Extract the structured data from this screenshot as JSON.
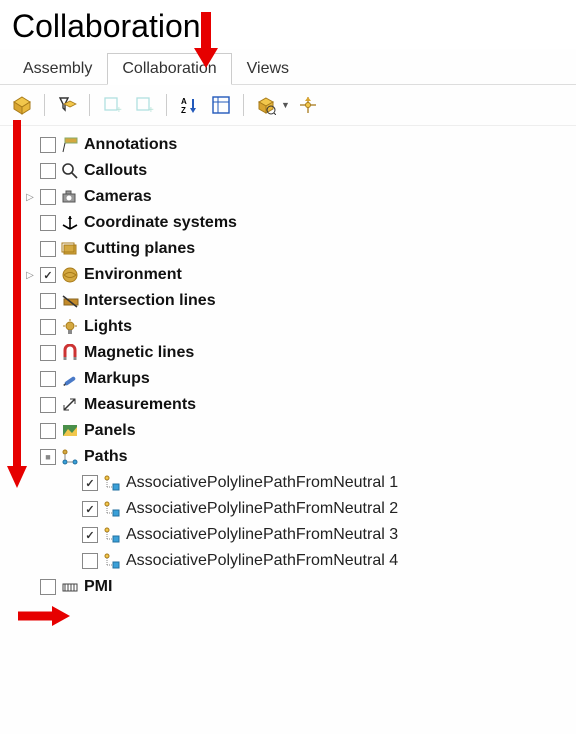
{
  "title": "Collaboration",
  "tabs": [
    {
      "label": "Assembly",
      "active": false
    },
    {
      "label": "Collaboration",
      "active": true
    },
    {
      "label": "Views",
      "active": false
    }
  ],
  "toolbar": {
    "items": [
      {
        "name": "component-icon",
        "disabled": false
      },
      {
        "name": "filter-icon",
        "disabled": false
      },
      {
        "name": "add-cube1-icon",
        "disabled": true
      },
      {
        "name": "add-cube2-icon",
        "disabled": true
      },
      {
        "name": "sort-az-icon",
        "disabled": false
      },
      {
        "name": "grid-icon",
        "disabled": false
      },
      {
        "name": "package-dropdown-icon",
        "disabled": false,
        "dropdown": true
      },
      {
        "name": "compass-icon",
        "disabled": false
      }
    ]
  },
  "tree": [
    {
      "id": "annotations",
      "label": "Annotations",
      "checked": false,
      "iconColor": "#d4a840"
    },
    {
      "id": "callouts",
      "label": "Callouts",
      "checked": false,
      "iconColor": "#444"
    },
    {
      "id": "cameras",
      "label": "Cameras",
      "checked": false,
      "hasExpand": true,
      "iconColor": "#777"
    },
    {
      "id": "coord",
      "label": "Coordinate systems",
      "checked": false,
      "iconColor": "#000"
    },
    {
      "id": "cutting",
      "label": "Cutting planes",
      "checked": false,
      "iconColor": "#d4a840"
    },
    {
      "id": "env",
      "label": "Environment",
      "checked": true,
      "hasExpand": true,
      "iconColor": "#d4a840"
    },
    {
      "id": "intersect",
      "label": "Intersection lines",
      "checked": false,
      "iconColor": "#c38a2a"
    },
    {
      "id": "lights",
      "label": "Lights",
      "checked": false,
      "iconColor": "#d4a840"
    },
    {
      "id": "magnetic",
      "label": "Magnetic lines",
      "checked": false,
      "iconColor": "#c33"
    },
    {
      "id": "markups",
      "label": "Markups",
      "checked": false,
      "iconColor": "#4a7ac7"
    },
    {
      "id": "measurements",
      "label": "Measurements",
      "checked": false,
      "iconColor": "#333"
    },
    {
      "id": "panels",
      "label": "Panels",
      "checked": false,
      "iconColor": "#3a7a3a"
    },
    {
      "id": "paths",
      "label": "Paths",
      "checked": "mixed",
      "expanded": true,
      "iconColor": "#d4a840",
      "children": [
        {
          "id": "path1",
          "label": "AssociativePolylinePathFromNeutral 1",
          "checked": true
        },
        {
          "id": "path2",
          "label": "AssociativePolylinePathFromNeutral 2",
          "checked": true
        },
        {
          "id": "path3",
          "label": "AssociativePolylinePathFromNeutral 3",
          "checked": true
        },
        {
          "id": "path4",
          "label": "AssociativePolylinePathFromNeutral 4",
          "checked": false
        }
      ]
    },
    {
      "id": "pmi",
      "label": "PMI",
      "checked": false,
      "iconColor": "#444"
    }
  ],
  "annotations": {
    "arrowColor": "#e60000"
  }
}
